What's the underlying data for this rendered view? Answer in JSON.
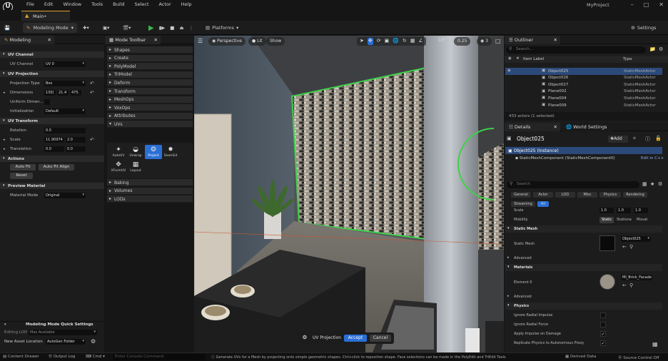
{
  "app": {
    "logo": "U",
    "menu": [
      "File",
      "Edit",
      "Window",
      "Tools",
      "Build",
      "Select",
      "Actor",
      "Help"
    ],
    "project_name": "MyProject",
    "level_tab": "Main•",
    "window_controls": [
      "–",
      "□",
      "✕"
    ]
  },
  "toolbar": {
    "mode_label": "Modeling Mode",
    "platforms_label": "Platforms",
    "settings_label": "Settings"
  },
  "modeling_panel": {
    "tab": "Modeling",
    "sections": {
      "uv_channel": "UV Channel",
      "uv_projection": "UV Projection",
      "uv_transform": "UV Transform",
      "actions": "Actions",
      "preview_material": "Preview Material"
    },
    "uv_channel": {
      "label": "UV Channel",
      "value": "UV 0"
    },
    "projection_type": {
      "label": "Projection Type",
      "value": "Box"
    },
    "dimensions": {
      "label": "Dimensions",
      "values": [
        "130(",
        "21.4",
        "475."
      ]
    },
    "uniform_dimensions": {
      "label": "Uniform Dimen..."
    },
    "initialization": {
      "label": "Initialization",
      "value": "Default"
    },
    "rotation": {
      "label": "Rotation",
      "value": "0.0"
    },
    "scale": {
      "label": "Scale",
      "values": [
        "11.90974",
        "2.0"
      ]
    },
    "translation": {
      "label": "Translation",
      "values": [
        "0.0",
        "0.0"
      ]
    },
    "buttons": {
      "auto_fit": "Auto Fit",
      "auto_fit_align": "Auto Fit Align",
      "reset": "Reset"
    },
    "material_mode": {
      "label": "Material Mode",
      "value": "Original"
    },
    "quick_settings": {
      "title": "Modeling Mode Quick Settings",
      "editing_lod": {
        "label": "Editing LOD",
        "value": "Max Available"
      },
      "new_asset_location": {
        "label": "New Asset Location",
        "value": "AutoGen Folder"
      }
    }
  },
  "mode_toolbar": {
    "tab": "Mode Toolbar",
    "categories_top": [
      "Shapes",
      "Create",
      "PolyModel",
      "TriModel",
      "Deform",
      "Transform",
      "MeshOps",
      "VoxOps",
      "Attributes",
      "UVs"
    ],
    "uv_tools": [
      {
        "label": "AutoUV",
        "icon": "autouv-icon",
        "glyph": "✦"
      },
      {
        "label": "Unwrap",
        "icon": "unwrap-icon",
        "glyph": "◒"
      },
      {
        "label": "Project",
        "icon": "project-icon",
        "glyph": "❂"
      },
      {
        "label": "SeamEd",
        "icon": "seam-editor-icon",
        "glyph": "✸"
      },
      {
        "label": "XFormUV",
        "icon": "xform-uv-icon",
        "glyph": "✥"
      },
      {
        "label": "Layout",
        "icon": "layout-icon",
        "glyph": "▦"
      }
    ],
    "categories_bottom": [
      "Baking",
      "Volumes",
      "LODs"
    ]
  },
  "viewport": {
    "perspective": "Perspective",
    "lit": "Lit",
    "show": "Show",
    "fov": "10°",
    "snap_value": "0.25",
    "camera_speed": "3",
    "overlay": {
      "title": "UV Projection",
      "accept": "Accept",
      "cancel": "Cancel"
    }
  },
  "outliner": {
    "tab": "Outliner",
    "search_placeholder": "Search...",
    "col_label": "Item Label",
    "col_type": "Type",
    "rows": [
      {
        "name": "Object025",
        "type": "StaticMeshActor"
      },
      {
        "name": "Object026",
        "type": "StaticMeshActor"
      },
      {
        "name": "Object027",
        "type": "StaticMeshActor"
      },
      {
        "name": "Plane002",
        "type": "StaticMeshActor"
      },
      {
        "name": "Plane004",
        "type": "StaticMeshActor"
      },
      {
        "name": "Plane009",
        "type": "StaticMeshActor"
      }
    ],
    "count": "433 actors (1 selected)"
  },
  "details": {
    "tab": "Details",
    "world_settings_tab": "World Settings",
    "object_name": "Object025",
    "add_label": "Add",
    "instance_label": "Object025 (Instance)",
    "component_label": "StaticMeshComponent (StaticMeshComponent0)",
    "edit_cpp": "Edit in C++",
    "search_placeholder": "Search",
    "filters_row1": [
      "General",
      "Actor",
      "LOD",
      "Misc",
      "Physics",
      "Rendering"
    ],
    "filters_row2": [
      "Streaming",
      "All"
    ],
    "scale_label": "Scale",
    "scale_values": [
      "1.0",
      "1.0",
      "1.0"
    ],
    "mobility": {
      "label": "Mobility",
      "options": [
        "Static",
        "Stationa",
        "Movat"
      ]
    },
    "static_mesh_section": "Static Mesh",
    "static_mesh_label": "Static Mesh",
    "static_mesh_value": "Object025",
    "advanced": "Advanced",
    "materials_section": "Materials",
    "element0_label": "Element 0",
    "material_value": "MI_Brick_Facade",
    "physics_section": "Physics",
    "physics_rows": [
      {
        "label": "Ignore Radial Impulse",
        "checked": false
      },
      {
        "label": "Ignore Radial Force",
        "checked": false
      },
      {
        "label": "Apply Impulse on Damage",
        "checked": true
      },
      {
        "label": "Replicate Physics to Autonomous Proxy",
        "checked": true
      }
    ]
  },
  "statusbar": {
    "content_drawer": "Content Drawer",
    "output_log": "Output Log",
    "cmd": "Cmd",
    "console_placeholder": "Enter Console Command",
    "hint": "Generate UVs for a Mesh by projecting onto simple geometric shapes. Ctrl+click to reposition shape. Face selections can be made in the PolyEdit and TriEdit Tools",
    "derived_data": "Derived Data",
    "source_control": "Source Control Off"
  },
  "colors": {
    "accent": "#2a6fd6",
    "play": "#3cb64a",
    "selection": "#2b4a7a"
  }
}
